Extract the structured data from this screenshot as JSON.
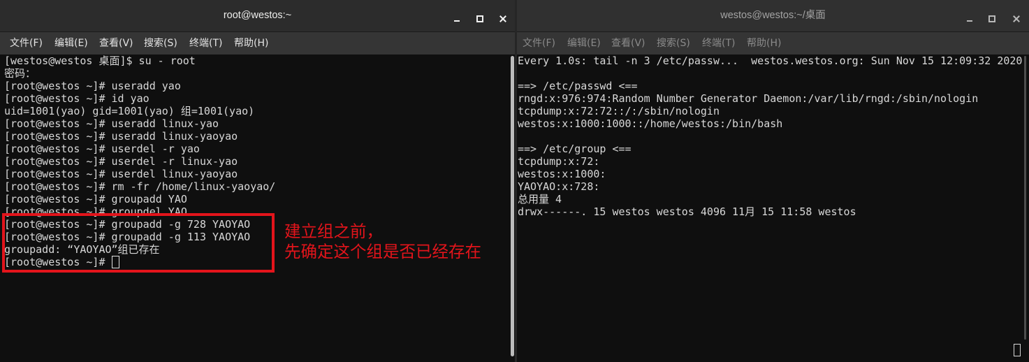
{
  "left_window": {
    "title": "root@westos:~",
    "menu": [
      "文件(F)",
      "编辑(E)",
      "查看(V)",
      "搜索(S)",
      "终端(T)",
      "帮助(H)"
    ],
    "lines": [
      "[westos@westos 桌面]$ su - root",
      "密码：",
      "[root@westos ~]# useradd yao",
      "[root@westos ~]# id yao",
      "uid=1001(yao) gid=1001(yao) 组=1001(yao)",
      "[root@westos ~]# useradd linux-yao",
      "[root@westos ~]# useradd linux-yaoyao",
      "[root@westos ~]# userdel -r yao",
      "[root@westos ~]# userdel -r linux-yao",
      "[root@westos ~]# userdel linux-yaoyao",
      "[root@westos ~]# rm -fr /home/linux-yaoyao/",
      "[root@westos ~]# groupadd YAO",
      "[root@westos ~]# groupdel YAO",
      "[root@westos ~]# groupadd -g 728 YAOYAO",
      "[root@westos ~]# groupadd -g 113 YAOYAO",
      "groupadd: “YAOYAO”组已存在",
      "[root@westos ~]# "
    ]
  },
  "right_window": {
    "title": "westos@westos:~/桌面",
    "menu": [
      "文件(F)",
      "编辑(E)",
      "查看(V)",
      "搜索(S)",
      "终端(T)",
      "帮助(H)"
    ],
    "lines": [
      "Every 1.0s: tail -n 3 /etc/passw...  westos.westos.org: Sun Nov 15 12:09:32 2020",
      "",
      "==> /etc/passwd <==",
      "rngd:x:976:974:Random Number Generator Daemon:/var/lib/rngd:/sbin/nologin",
      "tcpdump:x:72:72::/:/sbin/nologin",
      "westos:x:1000:1000::/home/westos:/bin/bash",
      "",
      "==> /etc/group <==",
      "tcpdump:x:72:",
      "westos:x:1000:",
      "YAOYAO:x:728:",
      "总用量 4",
      "drwx------. 15 westos westos 4096 11月 15 11:58 westos"
    ]
  },
  "window_controls": [
    "minimize-icon",
    "maximize-icon",
    "close-icon"
  ],
  "annotation": {
    "lines": [
      "建立组之前，",
      "先确定这个组是否已经存在"
    ]
  },
  "colors": {
    "terminal_bg": "#0f0f0f",
    "terminal_fg": "#d8d8d8",
    "titlebar_active": "#2c2c2c",
    "titlebar_inactive": "#303030",
    "annotation_red": "#e3141b"
  }
}
